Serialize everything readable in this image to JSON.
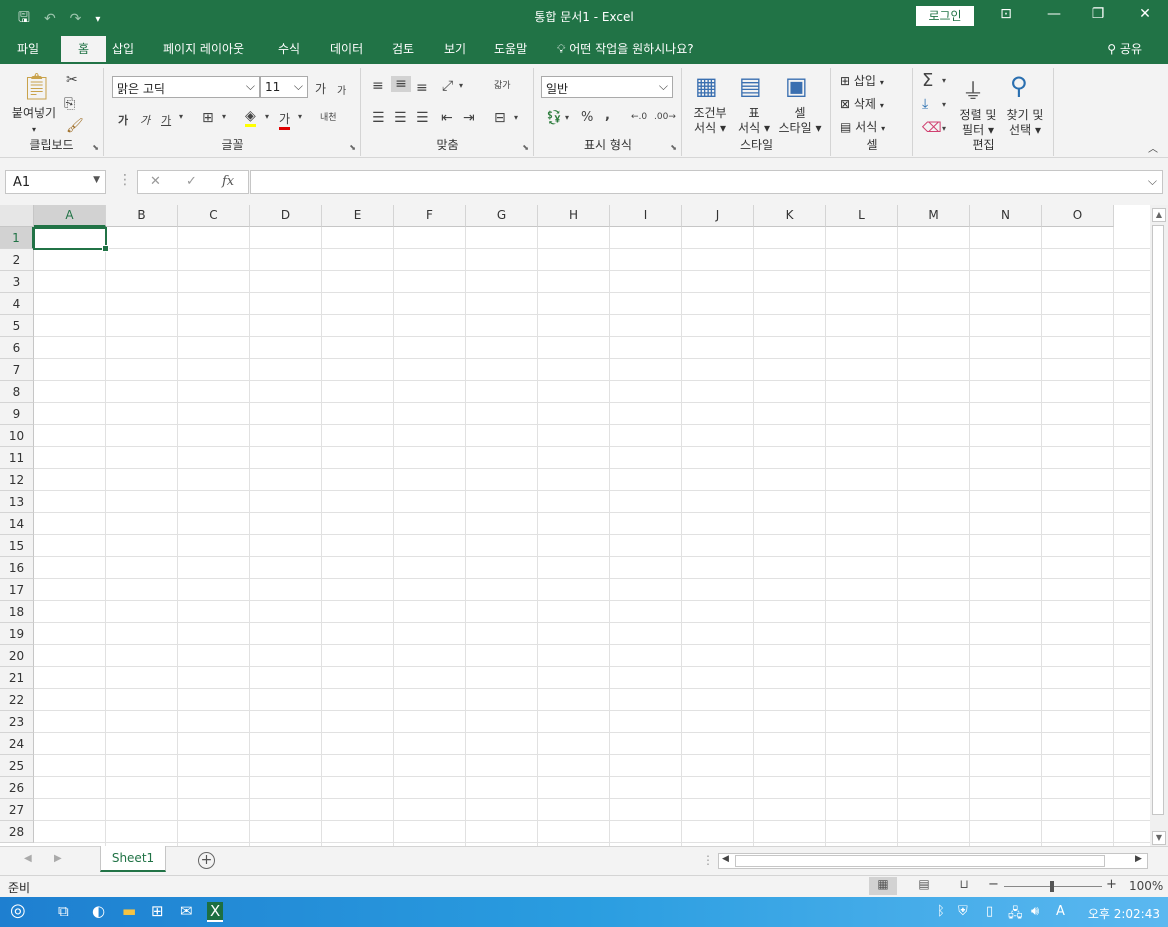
{
  "titlebar": {
    "title": "통합 문서1  -  Excel",
    "login": "로그인",
    "icons": [
      "save-icon",
      "undo-icon",
      "redo-icon",
      "customize-qat-icon",
      "ribbon-display-icon",
      "minimize-icon",
      "restore-icon",
      "close-icon"
    ]
  },
  "tabs": {
    "file": "파일",
    "home": "홈",
    "insert": "삽입",
    "layout": "페이지 레이아웃",
    "formulas": "수식",
    "data": "데이터",
    "review": "검토",
    "view": "보기",
    "help": "도움말",
    "tellme": "어떤 작업을 원하시나요?",
    "share": "공유"
  },
  "ribbon": {
    "clipboard": {
      "label": "클립보드",
      "paste": "붙여넣기"
    },
    "font": {
      "label": "글꼴",
      "font_name": "맑은 고딕",
      "font_size": "11",
      "grow": "가",
      "shrink": "가",
      "bold": "가",
      "italic": "가",
      "underline": "가",
      "font_color": "가",
      "phonetic": "내천"
    },
    "alignment": {
      "label": "맞춤",
      "wrap": "갋가"
    },
    "number": {
      "label": "표시 형식",
      "format": "일반",
      "percent": "%",
      "comma": ","
    },
    "styles": {
      "label": "스타일",
      "conditional": "조건부\n서식",
      "conditional_1": "조건부",
      "conditional_2": "서식",
      "table_1": "표",
      "table_2": "서식",
      "cell_1": "셀",
      "cell_2": "스타일"
    },
    "cells": {
      "label": "셀",
      "insert": "삽입",
      "delete": "삭제",
      "format": "서식"
    },
    "editing": {
      "label": "편집",
      "sort_1": "정렬 및",
      "sort_2": "필터",
      "find_1": "찾기 및",
      "find_2": "선택"
    }
  },
  "formula_bar": {
    "name_box": "A1",
    "fx": "fx",
    "value": ""
  },
  "columns": [
    "A",
    "B",
    "C",
    "D",
    "E",
    "F",
    "G",
    "H",
    "I",
    "J",
    "K",
    "L",
    "M",
    "N",
    "O"
  ],
  "rows": [
    "1",
    "2",
    "3",
    "4",
    "5",
    "6",
    "7",
    "8",
    "9",
    "10",
    "11",
    "12",
    "13",
    "14",
    "15",
    "16",
    "17",
    "18",
    "19",
    "20",
    "21",
    "22",
    "23",
    "24",
    "25",
    "26",
    "27",
    "28"
  ],
  "selected_cell": "A1",
  "sheets": [
    "Sheet1"
  ],
  "status": {
    "ready": "준비",
    "zoom": "100%",
    "zoom_level": 100
  },
  "taskbar": {
    "time": "오후 2:02:43",
    "ime": "A"
  },
  "colors": {
    "accent": "#217346",
    "ribbon_bg": "#f3f3f3",
    "taskbar": "#2a9de0"
  }
}
